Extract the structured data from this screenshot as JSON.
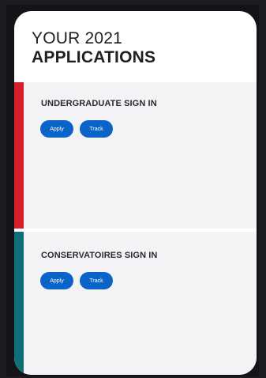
{
  "header": {
    "title_line1": "YOUR 2021",
    "title_line2": "APPLICATIONS"
  },
  "sections": [
    {
      "heading": "UNDERGRADUATE SIGN IN",
      "accent_color": "#d6202b",
      "buttons": {
        "apply": "Apply",
        "track": "Track"
      }
    },
    {
      "heading": "CONSERVATOIRES SIGN IN",
      "accent_color": "#0f6f78",
      "buttons": {
        "apply": "Apply",
        "track": "Track"
      }
    }
  ],
  "colors": {
    "button": "#0a63c7",
    "panel_bg": "#f3f3f6",
    "card_bg": "#ffffff",
    "page_bg": "#1c1c20"
  }
}
